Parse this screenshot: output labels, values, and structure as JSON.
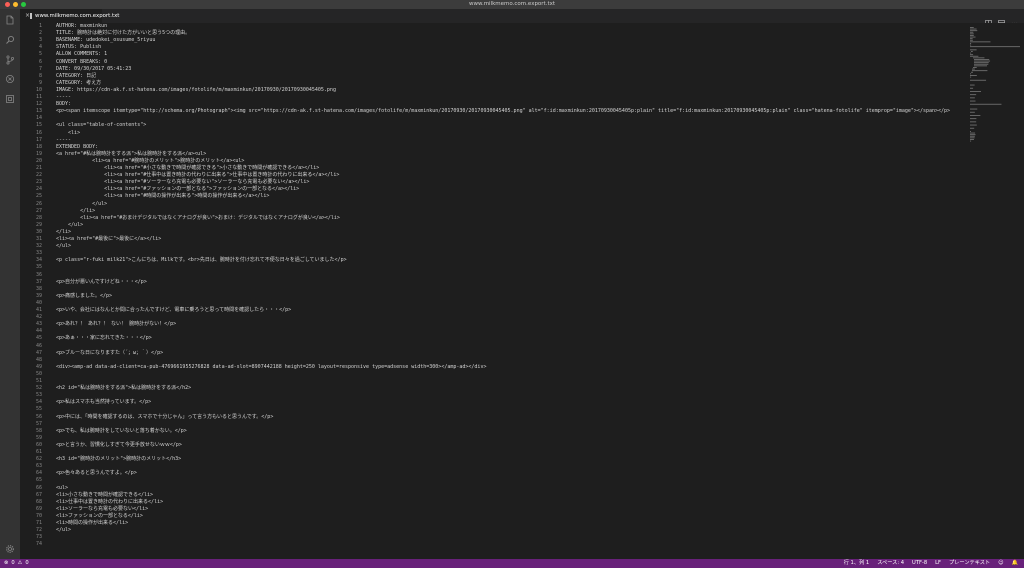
{
  "window": {
    "title": "www.milkmemo.com.export.txt"
  },
  "tab": {
    "label": "www.milkmemo.com.export.txt",
    "close_glyph": "×"
  },
  "activity_icons": [
    "files-icon",
    "search-icon",
    "source-control-icon",
    "debug-icon",
    "extensions-icon"
  ],
  "editor": {
    "lines": [
      {
        "n": "1",
        "text": "AUTHOR: maxminkun"
      },
      {
        "n": "2",
        "text": "TITLE: 腕時計は絶対に付けた方がいいと思う5つの理由。"
      },
      {
        "n": "3",
        "text": "BASENAME: udedokei_osusume_5riyuu"
      },
      {
        "n": "4",
        "text": "STATUS: Publish"
      },
      {
        "n": "5",
        "text": "ALLOW COMMENTS: 1"
      },
      {
        "n": "6",
        "text": "CONVERT BREAKS: 0"
      },
      {
        "n": "7",
        "text": "DATE: 09/30/2017 05:41:23"
      },
      {
        "n": "8",
        "text": "CATEGORY: 日記"
      },
      {
        "n": "9",
        "text": "CATEGORY: 考え方"
      },
      {
        "n": "10",
        "text": "IMAGE: https://cdn-ak.f.st-hatena.com/images/fotolife/m/maxminkun/20170930/20170930045405.png"
      },
      {
        "n": "11",
        "text": "-----"
      },
      {
        "n": "12",
        "text": "BODY:"
      },
      {
        "n": "13",
        "text": "<p><span itemscope itemtype=\"http://schema.org/Photograph\"><img src=\"https://cdn-ak.f.st-hatena.com/images/fotolife/m/maxminkun/20170930/20170930045405.png\" alt=\"f:id:maxminkun:20170930045405p:plain\" title=\"f:id:maxminkun:20170930045405p:plain\" class=\"hatena-fotolife\" itemprop=\"image\"></span></p>"
      },
      {
        "n": "14",
        "text": ""
      },
      {
        "n": "15",
        "text": "<ul class=\"table-of-contents\">"
      },
      {
        "n": "16",
        "text": "    <li>"
      },
      {
        "n": "17",
        "text": "-----"
      },
      {
        "n": "18",
        "text": "EXTENDED BODY:"
      },
      {
        "n": "19",
        "text": "<a href=\"#私は腕時計をする派\">私は腕時計をする派</a><ul>"
      },
      {
        "n": "20",
        "text": "            <li><a href=\"#腕時計のメリット\">腕時計のメリット</a><ul>"
      },
      {
        "n": "21",
        "text": "                <li><a href=\"#小さな動きで時間が確認できる\">小さな動きで時間が確認できる</a></li>"
      },
      {
        "n": "22",
        "text": "                <li><a href=\"#仕事中は置き時計の代わりに出来る\">仕事中は置き時計の代わりに出来る</a></li>"
      },
      {
        "n": "23",
        "text": "                <li><a href=\"#ソーラーなら充電も必要ない\">ソーラーなら充電も必要ない</a></li>"
      },
      {
        "n": "24",
        "text": "                <li><a href=\"#ファッションの一部となる\">ファッションの一部となる</a></li>"
      },
      {
        "n": "25",
        "text": "                <li><a href=\"#時間の操作が出来る\">時間の操作が出来る</a></li>"
      },
      {
        "n": "26",
        "text": "            </ul>"
      },
      {
        "n": "27",
        "text": "        </li>"
      },
      {
        "n": "28",
        "text": "        <li><a href=\"#おまけデジタルではなくアナログが良い\">おまけ：デジタルではなくアナログが良い</a></li>"
      },
      {
        "n": "29",
        "text": "    </ul>"
      },
      {
        "n": "30",
        "text": "</li>"
      },
      {
        "n": "31",
        "text": "<li><a href=\"#最後に\">最後に</a></li>"
      },
      {
        "n": "32",
        "text": "</ul>"
      },
      {
        "n": "33",
        "text": ""
      },
      {
        "n": "34",
        "text": "<p class=\"r-fuki milk21\">こんにちは、Milkです。<br>先日は、腕時計を付け忘れて不便な日々を過ごしていました</p>"
      },
      {
        "n": "35",
        "text": ""
      },
      {
        "n": "36",
        "text": ""
      },
      {
        "n": "37",
        "text": "<p>自分が悪いんですけどね・・・</p>"
      },
      {
        "n": "38",
        "text": ""
      },
      {
        "n": "39",
        "text": "<p>痛感しました。</p>"
      },
      {
        "n": "40",
        "text": ""
      },
      {
        "n": "41",
        "text": "<p>いや、会社にはなんとか間に合ったんですけど、電車に乗ろうと思って時間を確認したら・・・</p>"
      },
      {
        "n": "42",
        "text": ""
      },
      {
        "n": "43",
        "text": "<p>あれ？！ あれ？！ ない！ 腕時計がない！</p>"
      },
      {
        "n": "44",
        "text": ""
      },
      {
        "n": "45",
        "text": "<p>あぁ・・・家に忘れてきた・・・</p>"
      },
      {
        "n": "46",
        "text": ""
      },
      {
        "n": "47",
        "text": "<p>ブルーな日になりますた（´；ω；｀）</p>"
      },
      {
        "n": "48",
        "text": ""
      },
      {
        "n": "49",
        "text": "<div><amp-ad data-ad-client=ca-pub-4769661955276828 data-ad-slot=8907442188 height=250 layout=responsive type=adsense width=300></amp-ad></div>"
      },
      {
        "n": "50",
        "text": ""
      },
      {
        "n": "51",
        "text": ""
      },
      {
        "n": "52",
        "text": "<h2 id=\"私は腕時計をする派\">私は腕時計をする派</h2>"
      },
      {
        "n": "53",
        "text": ""
      },
      {
        "n": "54",
        "text": "<p>私はスマホも当然持っています。</p>"
      },
      {
        "n": "55",
        "text": ""
      },
      {
        "n": "56",
        "text": "<p>中には、「時間を確認するのは、スマホで十分じゃん」って言う方もいると思うんです。</p>"
      },
      {
        "n": "57",
        "text": ""
      },
      {
        "n": "58",
        "text": "<p>でも、私は腕時計をしていないと落ち着かない。</p>"
      },
      {
        "n": "59",
        "text": ""
      },
      {
        "n": "60",
        "text": "<p>と言うか、習慣化しすぎて今更手放せないｗｗ</p>"
      },
      {
        "n": "61",
        "text": ""
      },
      {
        "n": "62",
        "text": "<h3 id=\"腕時計のメリット\">腕時計のメリット</h3>"
      },
      {
        "n": "63",
        "text": ""
      },
      {
        "n": "64",
        "text": "<p>色々あると思うんですよ。</p>"
      },
      {
        "n": "65",
        "text": ""
      },
      {
        "n": "66",
        "text": "<ul>"
      },
      {
        "n": "67",
        "text": "<li>小さな動きで時間が確認できる</li>"
      },
      {
        "n": "68",
        "text": "<li>仕事中は置き時計の代わりに出来る</li>"
      },
      {
        "n": "69",
        "text": "<li>ソーラーなら充電も必要ない</li>"
      },
      {
        "n": "70",
        "text": "<li>ファッションの一部となる</li>"
      },
      {
        "n": "71",
        "text": "<li>時間の操作が出来る</li>"
      },
      {
        "n": "72",
        "text": "</ul>"
      },
      {
        "n": "73",
        "text": ""
      },
      {
        "n": "74",
        "text": ""
      }
    ]
  },
  "status": {
    "errors": "0",
    "warnings": "0",
    "position": "行 1、列 1",
    "spaces": "スペース: 4",
    "encoding": "UTF-8",
    "eol": "LF",
    "language": "プレーンテキスト"
  },
  "colors": {
    "statusbar": "#68217a",
    "editor_bg": "#1e1e1e",
    "activitybar": "#333333"
  }
}
